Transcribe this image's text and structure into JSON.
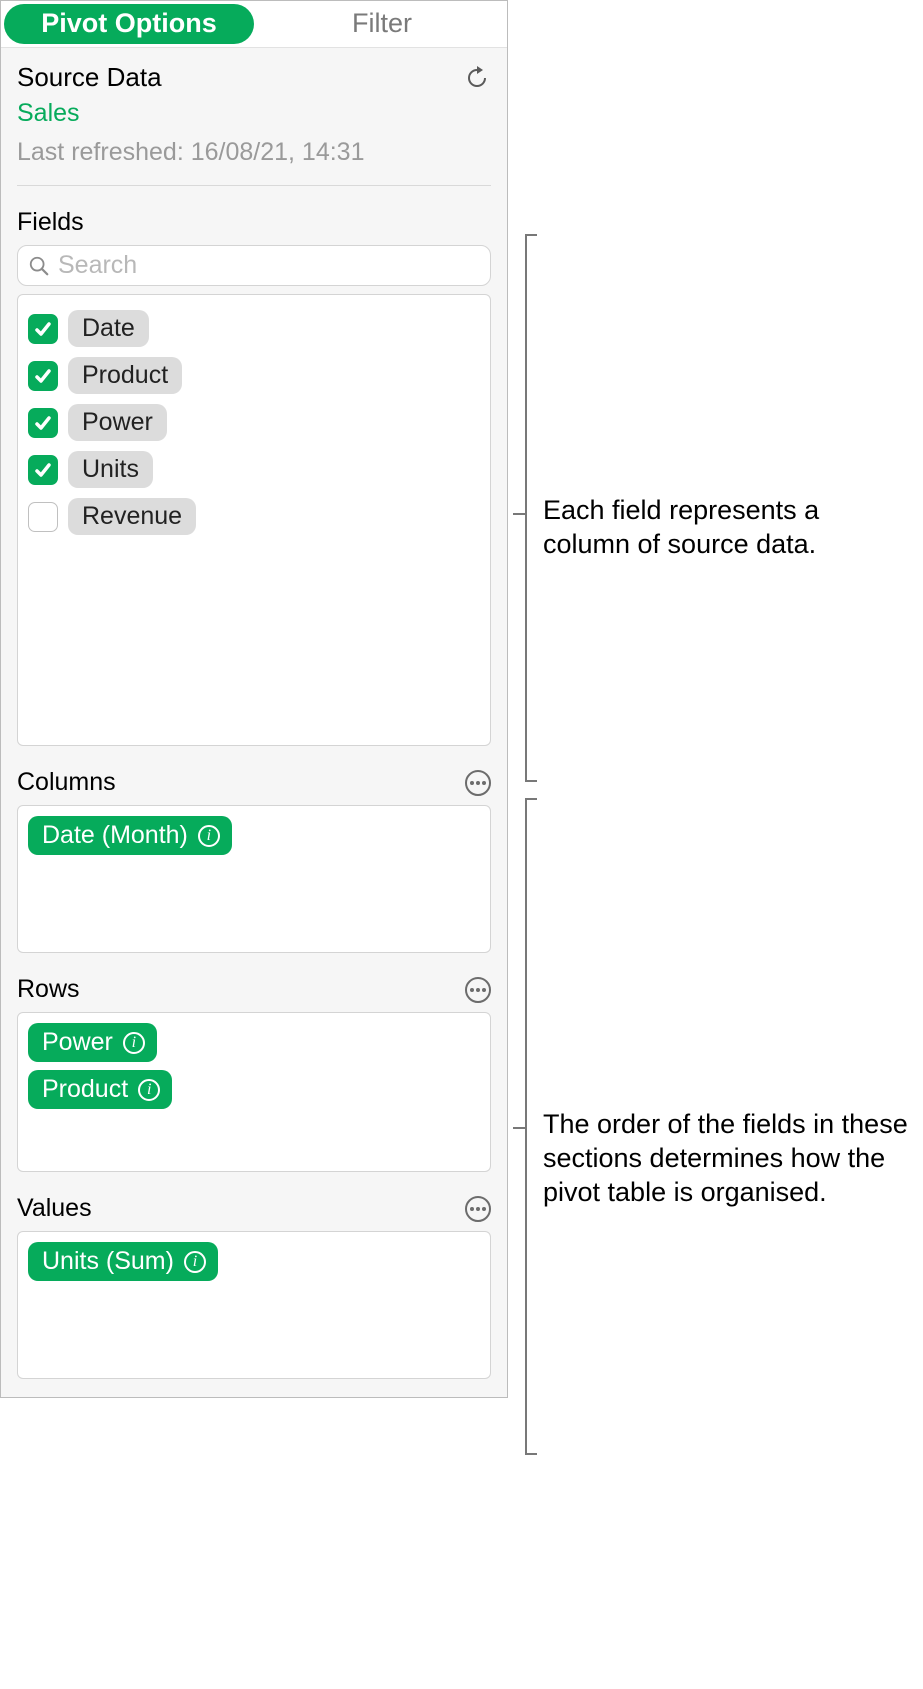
{
  "tabs": {
    "pivot": "Pivot Options",
    "filter": "Filter"
  },
  "source": {
    "label": "Source Data",
    "name": "Sales",
    "last_refreshed": "Last refreshed: 16/08/21, 14:31"
  },
  "fields": {
    "label": "Fields",
    "search_placeholder": "Search",
    "items": [
      {
        "label": "Date",
        "checked": true
      },
      {
        "label": "Product",
        "checked": true
      },
      {
        "label": "Power",
        "checked": true
      },
      {
        "label": "Units",
        "checked": true
      },
      {
        "label": "Revenue",
        "checked": false
      }
    ]
  },
  "columns": {
    "label": "Columns",
    "items": [
      "Date (Month)"
    ]
  },
  "rows": {
    "label": "Rows",
    "items": [
      "Power",
      "Product"
    ]
  },
  "values": {
    "label": "Values",
    "items": [
      "Units (Sum)"
    ]
  },
  "callouts": {
    "fields": "Each field represents a column of source data.",
    "sections": "The order of the fields in these sections determines how the pivot table is organised."
  }
}
